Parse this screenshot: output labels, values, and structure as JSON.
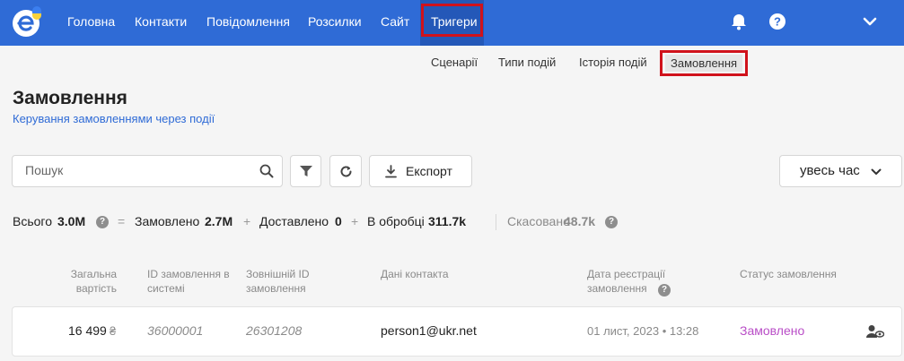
{
  "nav": {
    "items": [
      {
        "label": "Головна"
      },
      {
        "label": "Контакти"
      },
      {
        "label": "Повідомлення"
      },
      {
        "label": "Розсилки"
      },
      {
        "label": "Сайт"
      },
      {
        "label": "Тригери"
      }
    ],
    "icons": [
      "bell-icon",
      "help-icon",
      "chevron-down-icon"
    ],
    "highlight_color": "#d0121b",
    "bg_color": "#2f6bd6"
  },
  "subnav": {
    "items": [
      {
        "label": "Сценарії"
      },
      {
        "label": "Типи подій"
      },
      {
        "label": "Історія подій"
      },
      {
        "label": "Замовлення"
      }
    ]
  },
  "page": {
    "title": "Замовлення",
    "subtitle": "Керування замовленнями через події"
  },
  "toolbar": {
    "search_placeholder": "Пошук",
    "export_label": "Експорт",
    "period_label": "увесь час"
  },
  "stats": {
    "total_label": "Всього",
    "total_value": "3.0M",
    "eq": "=",
    "ordered_label": "Замовлено",
    "ordered_value": "2.7M",
    "plus1": "+",
    "delivered_label": "Доставлено",
    "delivered_value": "0",
    "plus2": "+",
    "processing_label": "В обробці",
    "processing_value": "311.7k",
    "cancelled_label": "Скасовано",
    "cancelled_value": "48.7k",
    "help": "?"
  },
  "table": {
    "headers": {
      "total_cost": "Загальна вартість",
      "order_id": "ID замовлення в системі",
      "external_id": "Зовнішній ID замовлення",
      "contact": "Дані контакта",
      "reg_date": "Дата реєстрації замовлення",
      "status": "Статус замовлення"
    },
    "rows": [
      {
        "cost": "16 499",
        "currency": "₴",
        "order_id": "36000001",
        "external_id": "26301208",
        "contact": "person1@ukr.net",
        "date": "01 лист, 2023 • 13:28",
        "status": "Замовлено"
      }
    ],
    "status_color": "#b94ec7"
  }
}
